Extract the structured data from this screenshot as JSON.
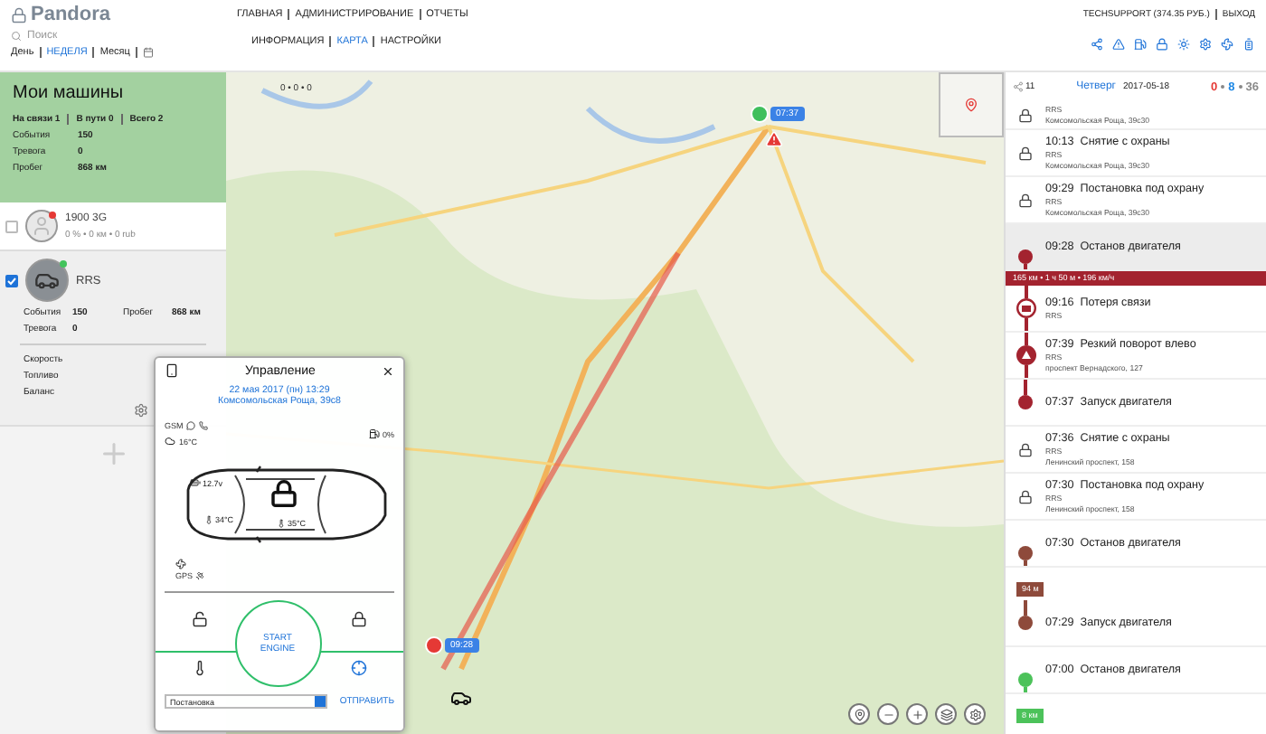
{
  "header": {
    "logo": "Pandora",
    "search": {
      "placeholder": "Поиск"
    },
    "nav": [
      {
        "label": "ГЛАВНАЯ"
      },
      {
        "label": "АДМИНИСТРИРОВАНИЕ"
      },
      {
        "label": "ОТЧЕТЫ"
      }
    ],
    "subnav": [
      {
        "label": "ИНФОРМАЦИЯ",
        "selected": false
      },
      {
        "label": "КАРТА",
        "selected": true
      },
      {
        "label": "НАСТРОЙКИ",
        "selected": false
      }
    ],
    "periods": [
      {
        "label": "День",
        "selected": false
      },
      {
        "label": "НЕДЕЛЯ",
        "selected": true
      },
      {
        "label": "Месяц",
        "selected": false
      }
    ],
    "account": "TECHSUPPORT (374.35 РУБ.)",
    "logout": "ВЫХОД"
  },
  "garage": {
    "title": "Мои машины",
    "summary": [
      "На связи 1",
      "В пути 0",
      "Всего 2"
    ],
    "stats": [
      {
        "label": "События",
        "value": "150"
      },
      {
        "label": "Тревога",
        "value": "0"
      },
      {
        "label": "Пробег",
        "value": "868 км"
      }
    ]
  },
  "cars": [
    {
      "name": "1900 3G",
      "checked": false,
      "photo": false,
      "color": "#e53935",
      "summary": "0 % • 0 км • 0 rub"
    },
    {
      "name": "RRS",
      "checked": true,
      "photo": true,
      "color": "#43c35c",
      "stats": [
        {
          "label": "События",
          "value": "150"
        },
        {
          "label": "Пробег",
          "value": "868 км"
        },
        {
          "label": "Тревога",
          "value": "0"
        }
      ],
      "details": [
        "Скорость",
        "Топливо",
        "Баланс"
      ]
    }
  ],
  "map": {
    "counter": "0 • 0 • 0",
    "markers": [
      {
        "kind": "start",
        "time": "07:37"
      },
      {
        "kind": "stop",
        "time": "09:28"
      }
    ]
  },
  "control": {
    "title": "Управление",
    "date": "22 мая 2017 (пн) 13:29",
    "address": "Комсомольская Роща, 39с8",
    "gsm": "GSM",
    "outside_temp": "16°C",
    "fuel": "0%",
    "voltage": "12.7v",
    "engine_temp": "34°C",
    "cabin_temp": "35°C",
    "gps": "GPS",
    "locked": true,
    "start": "START ENGINE",
    "command": "Постановка",
    "send": "ОТПРАВИТЬ"
  },
  "timeline": {
    "count": "11",
    "day": "Четверг",
    "date": "2017-05-18",
    "counters": [
      {
        "value": "0",
        "color": "#e53935"
      },
      {
        "value": "8",
        "color": "#1e88e5"
      },
      {
        "value": "36",
        "color": "#8a8a8a"
      }
    ],
    "events": [
      {
        "kind": "lock",
        "lines": [
          "RRS",
          "Комсомольская Роща, 39с30"
        ],
        "selected": false
      },
      {
        "kind": "lock",
        "time": "10:13",
        "title": "Снятие с охраны",
        "lines": [
          "RRS",
          "Комсомольская Роща, 39с30"
        ],
        "selected": false
      },
      {
        "kind": "lock",
        "time": "09:29",
        "title": "Постановка под охрану",
        "lines": [
          "RRS",
          "Комсомольская Роща, 39с30"
        ],
        "selected": false
      },
      {
        "kind": "dot",
        "time": "09:28",
        "title": "Останов двигателя",
        "color": "#a3232f",
        "line_above": false,
        "line_below": true,
        "selected": true
      },
      {
        "kind": "bar",
        "text": "165 км • 1 ч 50 м • 196 км/ч",
        "color": "#a3232f"
      },
      {
        "kind": "nosignal",
        "time": "09:16",
        "title": "Потеря связи",
        "lines": [
          "RRS"
        ],
        "color": "#a3232f",
        "line_above": true,
        "line_below": true,
        "selected": false
      },
      {
        "kind": "alert",
        "time": "07:39",
        "title": "Резкий поворот влево",
        "lines": [
          "RRS",
          "проспект Вернадского, 127"
        ],
        "color": "#a3232f",
        "line_above": true,
        "line_below": true,
        "selected": false
      },
      {
        "kind": "dot",
        "time": "07:37",
        "title": "Запуск двигателя",
        "color": "#a3232f",
        "line_above": true,
        "line_below": false,
        "selected": false
      },
      {
        "kind": "lock",
        "time": "07:36",
        "title": "Снятие с охраны",
        "lines": [
          "RRS",
          "Ленинский проспект, 158"
        ],
        "selected": false
      },
      {
        "kind": "lock",
        "time": "07:30",
        "title": "Постановка под охрану",
        "lines": [
          "RRS",
          "Ленинский проспект, 158"
        ],
        "selected": false
      },
      {
        "kind": "dot",
        "time": "07:30",
        "title": "Останов двигателя",
        "color": "#8e4a3b",
        "line_above": false,
        "line_below": true,
        "selected": false
      },
      {
        "kind": "badge",
        "text": "94 м",
        "color": "#8e4a3b"
      },
      {
        "kind": "dot",
        "time": "07:29",
        "title": "Запуск двигателя",
        "color": "#8e4a3b",
        "line_above": true,
        "line_below": false,
        "selected": false
      },
      {
        "kind": "dot",
        "time": "07:00",
        "title": "Останов двигателя",
        "color": "#4cc25a",
        "line_above": false,
        "line_below": true,
        "selected": false
      },
      {
        "kind": "badge",
        "text": "8 км",
        "color": "#4cc25a"
      }
    ]
  }
}
